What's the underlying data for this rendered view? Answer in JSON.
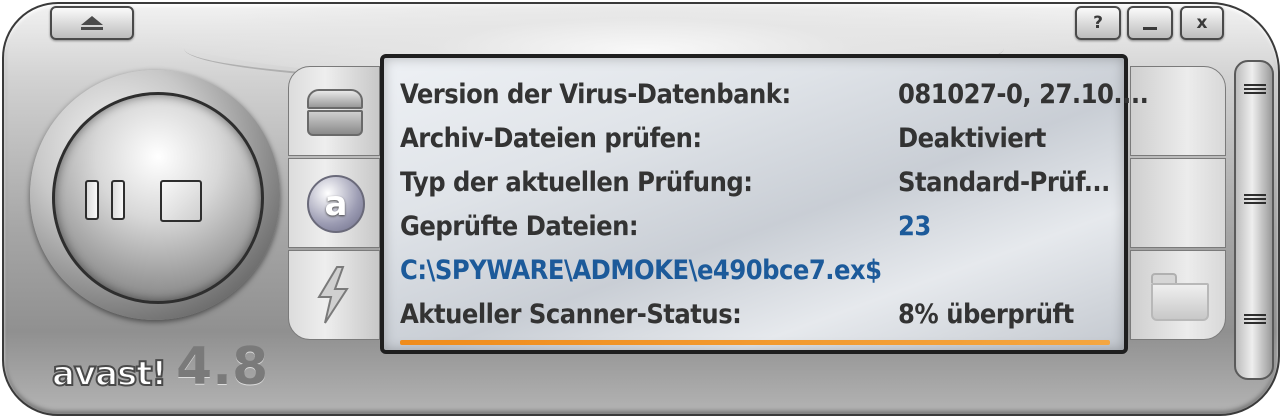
{
  "toolbar": {
    "eject_icon": "eject-icon",
    "help_label": "?",
    "minimize_icon": "minimize-icon",
    "close_label": "x"
  },
  "controls": {
    "pause_icon": "pause-icon",
    "stop_icon": "stop-icon"
  },
  "left_tabs": [
    {
      "icon": "chest-icon"
    },
    {
      "icon": "avast-a-icon",
      "glyph": "a"
    },
    {
      "icon": "lightning-icon"
    }
  ],
  "right_tabs": [
    {
      "icon": "blank"
    },
    {
      "icon": "blank"
    },
    {
      "icon": "folder-icon"
    }
  ],
  "display": {
    "rows": [
      {
        "label": "Version der Virus-Datenbank:",
        "value": "081027-0, 27.10...."
      },
      {
        "label": "Archiv-Dateien prüfen:",
        "value": "Deaktiviert"
      },
      {
        "label": "Typ der aktuellen Prüfung:",
        "value": "Standard-Prüf..."
      },
      {
        "label": "Geprüfte Dateien:",
        "value": "23"
      },
      {
        "label": "C:\\SPYWARE\\ADMOKE\\e490bce7.ex$",
        "value": ""
      },
      {
        "label": "Aktueller Scanner-Status:",
        "value": "8% überprüft"
      }
    ],
    "progress_percent": 8,
    "accent_color": "#1c5a9a",
    "progress_color": "#f08c1c"
  },
  "logo": {
    "brand": "avast!",
    "version": "4.8"
  }
}
